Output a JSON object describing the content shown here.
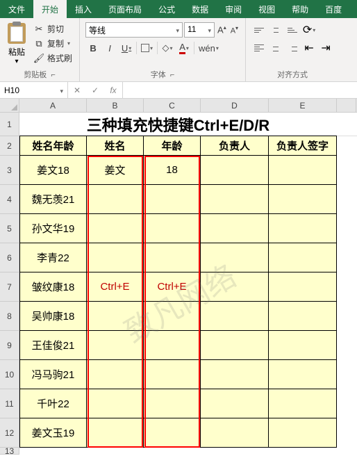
{
  "tabs": [
    "文件",
    "开始",
    "插入",
    "页面布局",
    "公式",
    "数据",
    "审阅",
    "视图",
    "帮助",
    "百度"
  ],
  "active_tab_index": 1,
  "ribbon": {
    "clipboard": {
      "paste": "粘贴",
      "cut": "剪切",
      "copy": "复制",
      "format_painter": "格式刷",
      "group": "剪贴板"
    },
    "font": {
      "name": "等线",
      "size": "11",
      "group": "字体",
      "bold": "B",
      "italic": "I",
      "underline": "U",
      "wen": "wén"
    },
    "align": {
      "group": "对齐方式"
    }
  },
  "formula_bar": {
    "name_box": "H10",
    "fx": "fx",
    "value": ""
  },
  "columns": [
    "A",
    "B",
    "C",
    "D",
    "E"
  ],
  "rows": [
    "1",
    "2",
    "3",
    "4",
    "5",
    "6",
    "7",
    "8",
    "9",
    "10",
    "11",
    "12",
    "13"
  ],
  "sheet": {
    "title": "三种填充快捷键Ctrl+E/D/R",
    "headers": [
      "姓名年龄",
      "姓名",
      "年龄",
      "负责人",
      "负责人签字"
    ],
    "data": [
      {
        "a": "姜文18",
        "b": "姜文",
        "c": "18"
      },
      {
        "a": "魏无羡21",
        "b": "",
        "c": ""
      },
      {
        "a": "孙文华19",
        "b": "",
        "c": ""
      },
      {
        "a": "李青22",
        "b": "",
        "c": ""
      },
      {
        "a": "皱纹康18",
        "b": "Ctrl+E",
        "c": "Ctrl+E"
      },
      {
        "a": "吴帅康18",
        "b": "",
        "c": ""
      },
      {
        "a": "王佳俊21",
        "b": "",
        "c": ""
      },
      {
        "a": "冯马驹21",
        "b": "",
        "c": ""
      },
      {
        "a": "千叶22",
        "b": "",
        "c": ""
      },
      {
        "a": "姜文玉19",
        "b": "",
        "c": ""
      }
    ]
  },
  "watermark": "致凡网络"
}
